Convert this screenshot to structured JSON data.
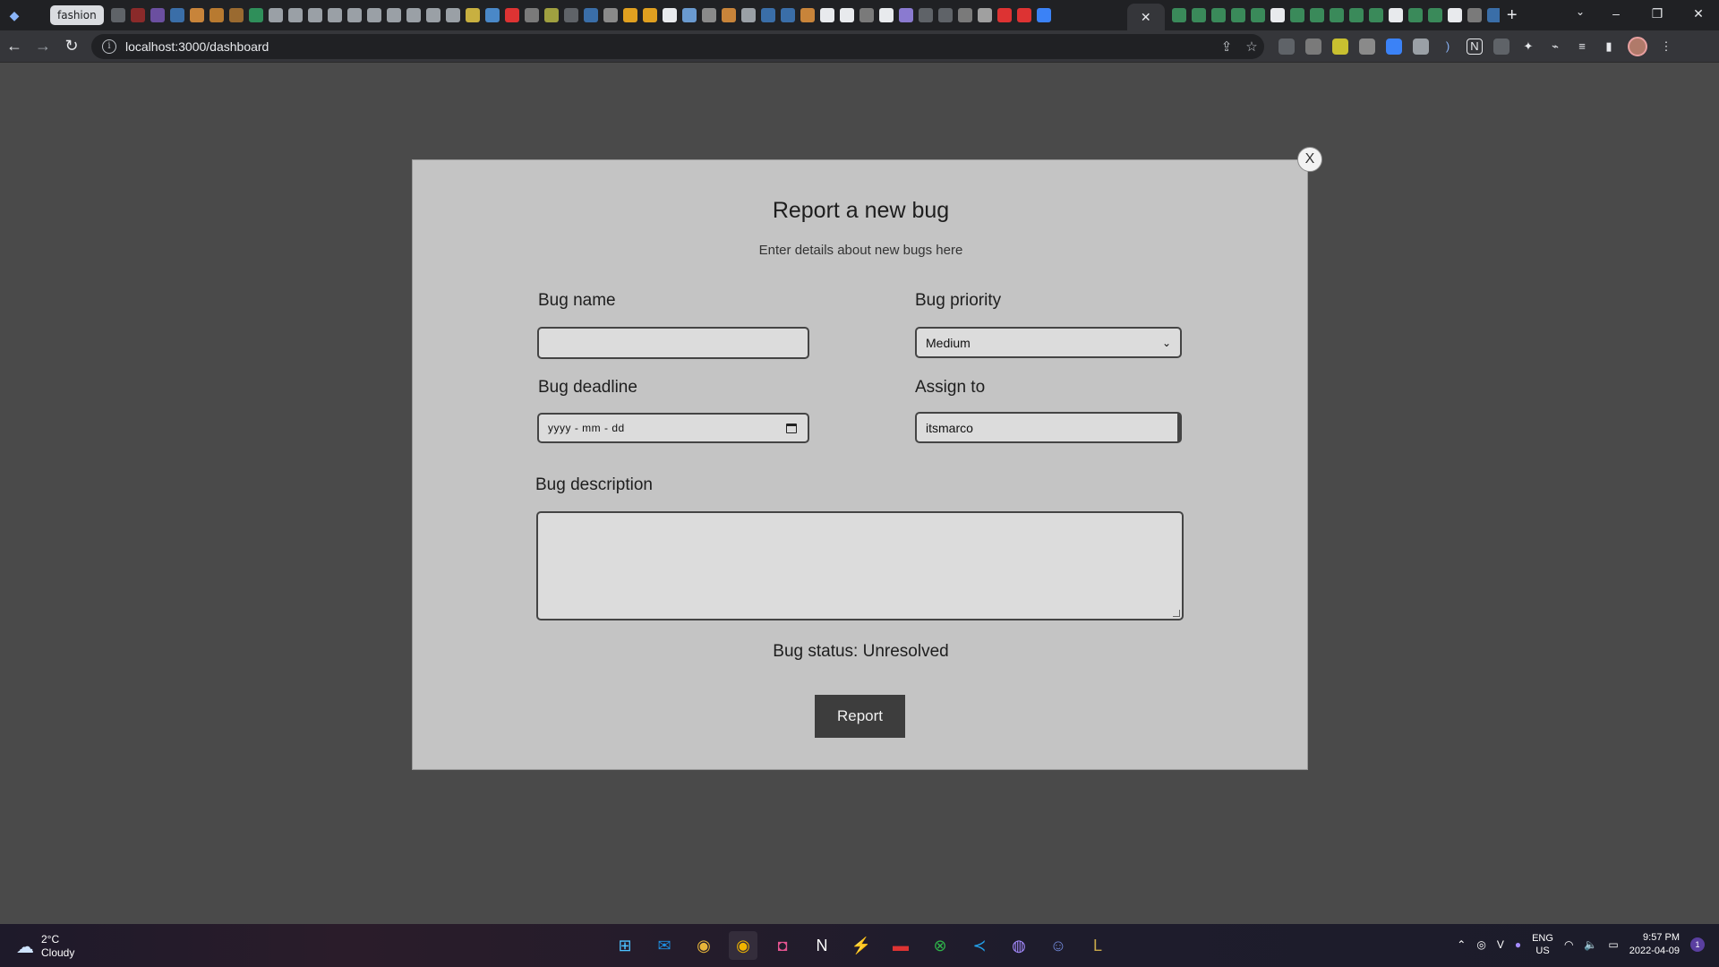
{
  "browser": {
    "pinned_tab_label": "fashion",
    "active_tab_close": "✕",
    "new_tab": "+",
    "url": "localhost:3000/dashboard",
    "window_controls": {
      "minimize": "–",
      "restore": "❐",
      "close": "✕"
    }
  },
  "modal": {
    "close_label": "X",
    "title": "Report a new bug",
    "subtitle": "Enter details about new bugs here",
    "fields": {
      "bug_name": {
        "label": "Bug name",
        "value": ""
      },
      "bug_priority": {
        "label": "Bug priority",
        "selected": "Medium"
      },
      "bug_deadline": {
        "label": "Bug deadline",
        "placeholder": "yyyy - mm - dd"
      },
      "assign_to": {
        "label": "Assign to",
        "value": "itsmarco"
      },
      "bug_description": {
        "label": "Bug description",
        "value": ""
      }
    },
    "status_text": "Bug status: Unresolved",
    "submit_label": "Report"
  },
  "taskbar": {
    "weather": {
      "temp": "2°C",
      "condition": "Cloudy"
    },
    "language": {
      "line1": "ENG",
      "line2": "US"
    },
    "clock": {
      "time": "9:57 PM",
      "date": "2022-04-09"
    },
    "notification_count": "1"
  },
  "colors": {
    "page_bg": "#4a4a4a",
    "modal_bg": "#c4c4c4",
    "field_bg": "#dcdcdc",
    "button_bg": "#3d3d3d"
  }
}
